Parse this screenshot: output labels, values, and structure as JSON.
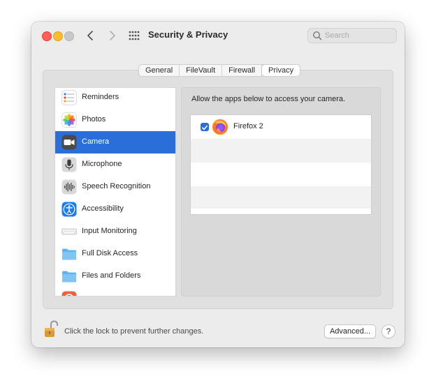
{
  "window": {
    "title": "Security & Privacy",
    "search_placeholder": "Search"
  },
  "tabs": [
    {
      "label": "General",
      "selected": false
    },
    {
      "label": "FileVault",
      "selected": false
    },
    {
      "label": "Firewall",
      "selected": false
    },
    {
      "label": "Privacy",
      "selected": true
    }
  ],
  "sidebar": {
    "items": [
      {
        "label": "Reminders",
        "icon": "reminders-icon",
        "selected": false
      },
      {
        "label": "Photos",
        "icon": "photos-icon",
        "selected": false
      },
      {
        "label": "Camera",
        "icon": "camera-icon",
        "selected": true
      },
      {
        "label": "Microphone",
        "icon": "microphone-icon",
        "selected": false
      },
      {
        "label": "Speech Recognition",
        "icon": "speech-recognition-icon",
        "selected": false
      },
      {
        "label": "Accessibility",
        "icon": "accessibility-icon",
        "selected": false
      },
      {
        "label": "Input Monitoring",
        "icon": "keyboard-icon",
        "selected": false
      },
      {
        "label": "Full Disk Access",
        "icon": "folder-icon",
        "selected": false
      },
      {
        "label": "Files and Folders",
        "icon": "folder-icon",
        "selected": false
      }
    ]
  },
  "main": {
    "heading": "Allow the apps below to access your camera.",
    "apps": [
      {
        "name": "Firefox 2",
        "checked": true,
        "icon": "firefox-icon"
      }
    ]
  },
  "footer": {
    "lock_text": "Click the lock to prevent further changes.",
    "advanced_label": "Advanced...",
    "help_label": "?"
  },
  "colors": {
    "accent": "#2a6fd9",
    "close": "#ff5f57",
    "minimize": "#febc2e",
    "zoom": "#c8c8c8"
  }
}
